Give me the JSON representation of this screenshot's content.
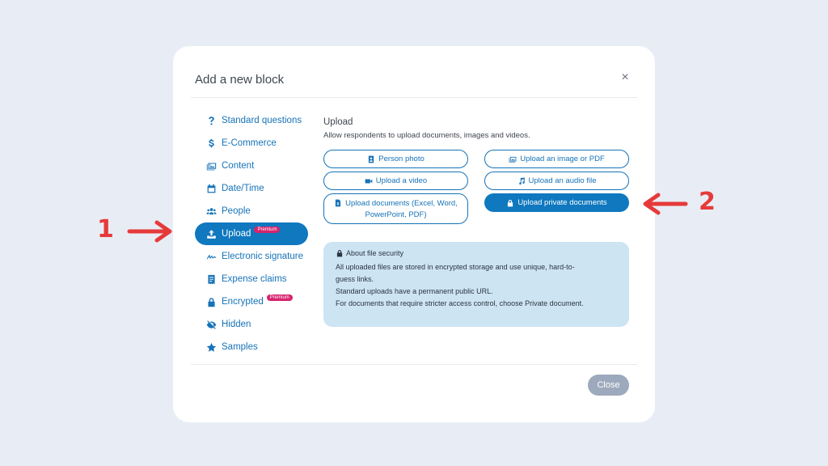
{
  "modal": {
    "title": "Add a new block",
    "close_glyph": "×",
    "close_button": "Close"
  },
  "sidebar": {
    "items": [
      {
        "label": "Standard questions",
        "icon": "question-icon"
      },
      {
        "label": "E-Commerce",
        "icon": "dollar-icon"
      },
      {
        "label": "Content",
        "icon": "images-icon"
      },
      {
        "label": "Date/Time",
        "icon": "calendar-icon"
      },
      {
        "label": "People",
        "icon": "people-icon"
      },
      {
        "label": "Upload",
        "icon": "upload-icon",
        "badge": "Premium",
        "active": true
      },
      {
        "label": "Electronic signature",
        "icon": "signature-icon"
      },
      {
        "label": "Expense claims",
        "icon": "receipt-icon"
      },
      {
        "label": "Encrypted",
        "icon": "lock-icon",
        "badge": "Premium"
      },
      {
        "label": "Hidden",
        "icon": "eye-slash-icon"
      },
      {
        "label": "Samples",
        "icon": "star-icon"
      }
    ]
  },
  "content": {
    "title": "Upload",
    "description": "Allow respondents to upload documents, images and videos.",
    "options": {
      "person_photo": "Person photo",
      "upload_image_pdf": "Upload an image or PDF",
      "upload_video": "Upload a video",
      "upload_audio": "Upload an audio file",
      "upload_documents_1": "Upload documents (Excel, Word,",
      "upload_documents_2": "PowerPoint, PDF)",
      "upload_private": "Upload private documents"
    }
  },
  "info": {
    "title": "About file security",
    "line1": "All uploaded files are stored in encrypted storage and use unique, hard-to-",
    "line2": "guess links.",
    "line3": "Standard uploads have a permanent public URL.",
    "line4": "For documents that require stricter access control, choose Private document."
  },
  "annotations": {
    "label_1": "1",
    "label_2": "2",
    "color": "#e63a3a"
  },
  "colors": {
    "accent": "#0f78bf",
    "premium_badge": "#d6246e",
    "info_bg": "#cde4f2"
  }
}
